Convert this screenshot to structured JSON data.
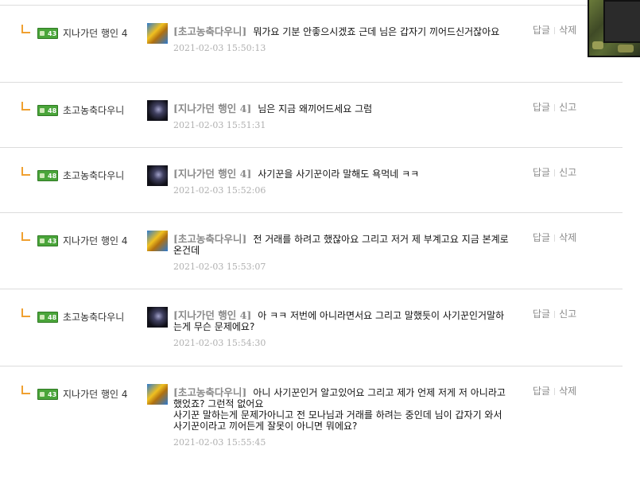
{
  "comments": [
    {
      "level": "43",
      "nickname": "지나가던 행인 4",
      "avatar": "avatar-yellow",
      "tag": "[초고농축다우니]",
      "text": "뭐가요 기분 안좋으시겠죠 근데 님은 갑자기 끼어드신거잖아요",
      "date": "2021-02-03 15:50:13",
      "actions": [
        "답글",
        "삭제"
      ]
    },
    {
      "level": "48",
      "nickname": "초고농축다우니",
      "avatar": "avatar-dark",
      "tag": "[지나가던 행인 4]",
      "text": "님은 지금 왜끼어드세요 그럼",
      "date": "2021-02-03 15:51:31",
      "actions": [
        "답글",
        "신고"
      ]
    },
    {
      "level": "48",
      "nickname": "초고농축다우니",
      "avatar": "avatar-dark",
      "tag": "[지나가던 행인 4]",
      "text": "사기꾼을 사기꾼이라 말해도 욕먹네 ㅋㅋ",
      "date": "2021-02-03 15:52:06",
      "actions": [
        "답글",
        "신고"
      ]
    },
    {
      "level": "43",
      "nickname": "지나가던 행인 4",
      "avatar": "avatar-yellow",
      "tag": "[초고농축다우니]",
      "text": "전 거래를 하려고 했잖아요 그리고 저거 제 부계고요 지금 본계로 온건데",
      "date": "2021-02-03 15:53:07",
      "actions": [
        "답글",
        "삭제"
      ]
    },
    {
      "level": "48",
      "nickname": "초고농축다우니",
      "avatar": "avatar-dark",
      "tag": "[지나가던 행인 4]",
      "text": "아 ㅋㅋ 저번에 아니라면서요 그리고 말했듯이 사기꾼인거말하는게 무슨 문제에요?",
      "date": "2021-02-03 15:54:30",
      "actions": [
        "답글",
        "신고"
      ]
    },
    {
      "level": "43",
      "nickname": "지나가던 행인 4",
      "avatar": "avatar-yellow",
      "tag": "[초고농축다우니]",
      "text": "아니 사기꾼인거 알고있어요 그리고 제가 언제 저게 저 아니라고 했었죠? 그런적 없어요",
      "text2": "사기꾼 말하는게 문제가아니고 전 모나님과 거래를 하려는 중인데 님이 갑자기 와서 사기꾼이라고 끼어든게 잘못이 아니면 뭐에요?",
      "date": "2021-02-03 15:55:45",
      "actions": [
        "답글",
        "삭제"
      ]
    }
  ]
}
